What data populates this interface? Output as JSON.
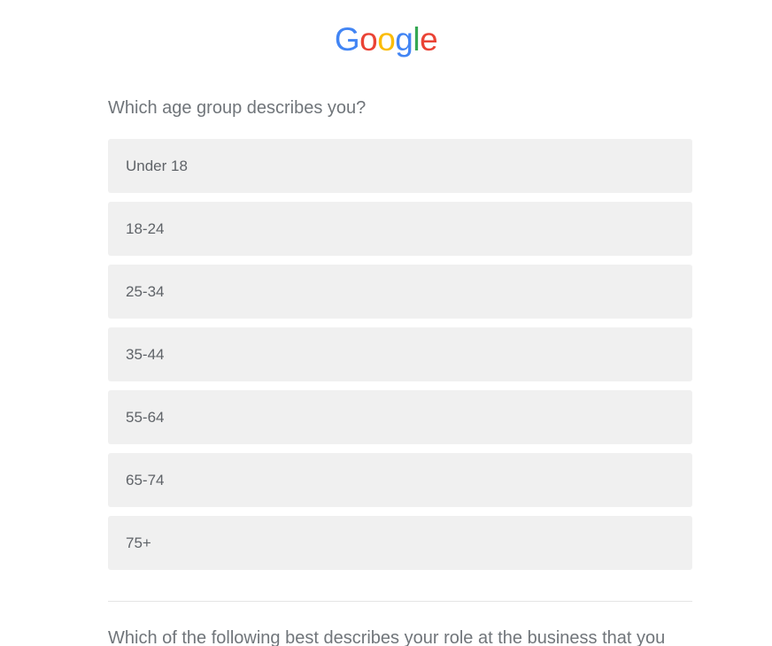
{
  "logo": {
    "letters": [
      {
        "char": "G",
        "color": "#4285F4"
      },
      {
        "char": "o",
        "color": "#EA4335"
      },
      {
        "char": "o",
        "color": "#FBBC05"
      },
      {
        "char": "g",
        "color": "#4285F4"
      },
      {
        "char": "l",
        "color": "#34A853"
      },
      {
        "char": "e",
        "color": "#EA4335"
      }
    ]
  },
  "age_question": {
    "title": "Which age group describes you?",
    "options": [
      {
        "label": "Under 18"
      },
      {
        "label": "18-24"
      },
      {
        "label": "25-34"
      },
      {
        "label": "35-44"
      },
      {
        "label": "55-64"
      },
      {
        "label": "65-74"
      },
      {
        "label": "75+"
      }
    ]
  },
  "role_question": {
    "title": "Which of the following best describes your role at the business that you"
  }
}
